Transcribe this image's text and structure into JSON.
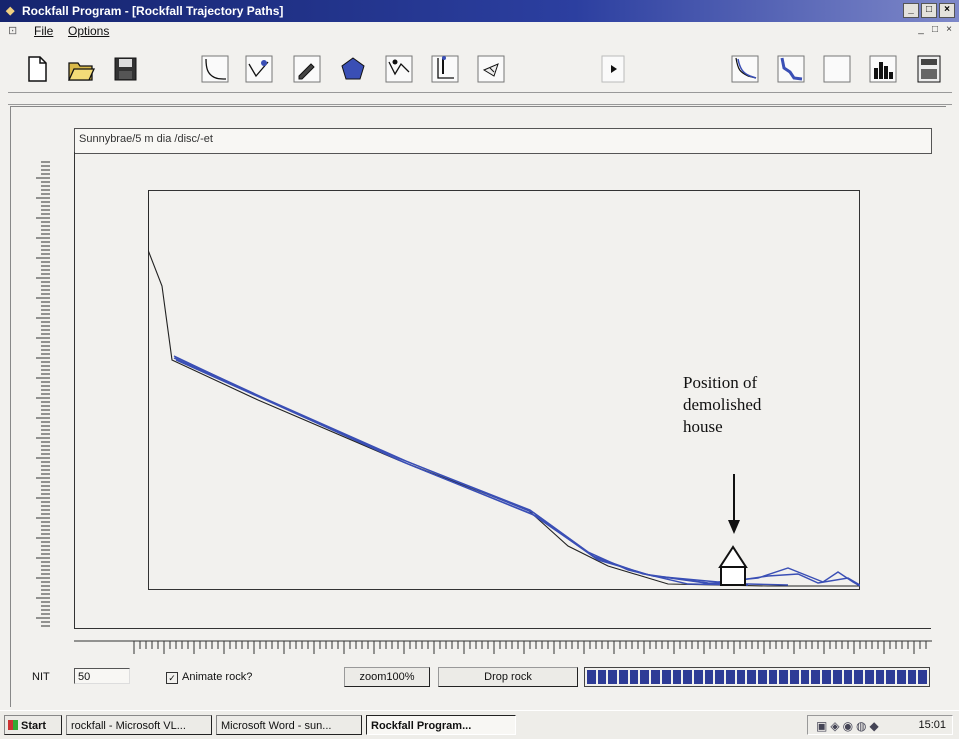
{
  "window": {
    "title": "Rockfall Program - [Rockfall Trajectory Paths]",
    "controls": [
      "_",
      "□",
      "×"
    ]
  },
  "menu": {
    "file": "File",
    "options": "Options",
    "mdi_controls": [
      "_",
      "□",
      "×"
    ]
  },
  "toolbar": {
    "buttons": [
      {
        "name": "new-file-icon"
      },
      {
        "name": "open-folder-icon"
      },
      {
        "name": "save-disk-icon"
      },
      {
        "name": "slope-profile-icon"
      },
      {
        "name": "slope-edit-icon"
      },
      {
        "name": "pencil-icon"
      },
      {
        "name": "polygon-icon"
      },
      {
        "name": "rock-start-icon"
      },
      {
        "name": "barrier-icon"
      },
      {
        "name": "flag-icon"
      },
      {
        "name": "play-icon"
      },
      {
        "name": "trajectory-paths-icon"
      },
      {
        "name": "trajectory-bounce-icon"
      },
      {
        "name": "blank-panel-icon"
      },
      {
        "name": "histogram-icon"
      },
      {
        "name": "calculator-icon"
      }
    ]
  },
  "document": {
    "label": "Sunnybrae/5 m dia /disc/-et"
  },
  "annotation": {
    "lines": [
      "Position of",
      "demolished",
      "house"
    ]
  },
  "bottom_bar": {
    "nit_label": "NIT",
    "nit_value": "50",
    "animate_checked": "✓",
    "animate_label": "Animate rock?",
    "zoom_label": "zoom100%",
    "drop_label": "Drop rock",
    "progress_value": 1.0
  },
  "taskbar": {
    "start": "Start",
    "items": [
      {
        "label": "rockfall - Microsoft VL..."
      },
      {
        "label": "Microsoft Word - sun..."
      },
      {
        "label": "Rockfall Program..."
      }
    ],
    "clock": "15:01"
  },
  "colors": {
    "titlebar": "#2c3fa0",
    "trajectory": "#3a4fb5",
    "profile": "#222222"
  }
}
